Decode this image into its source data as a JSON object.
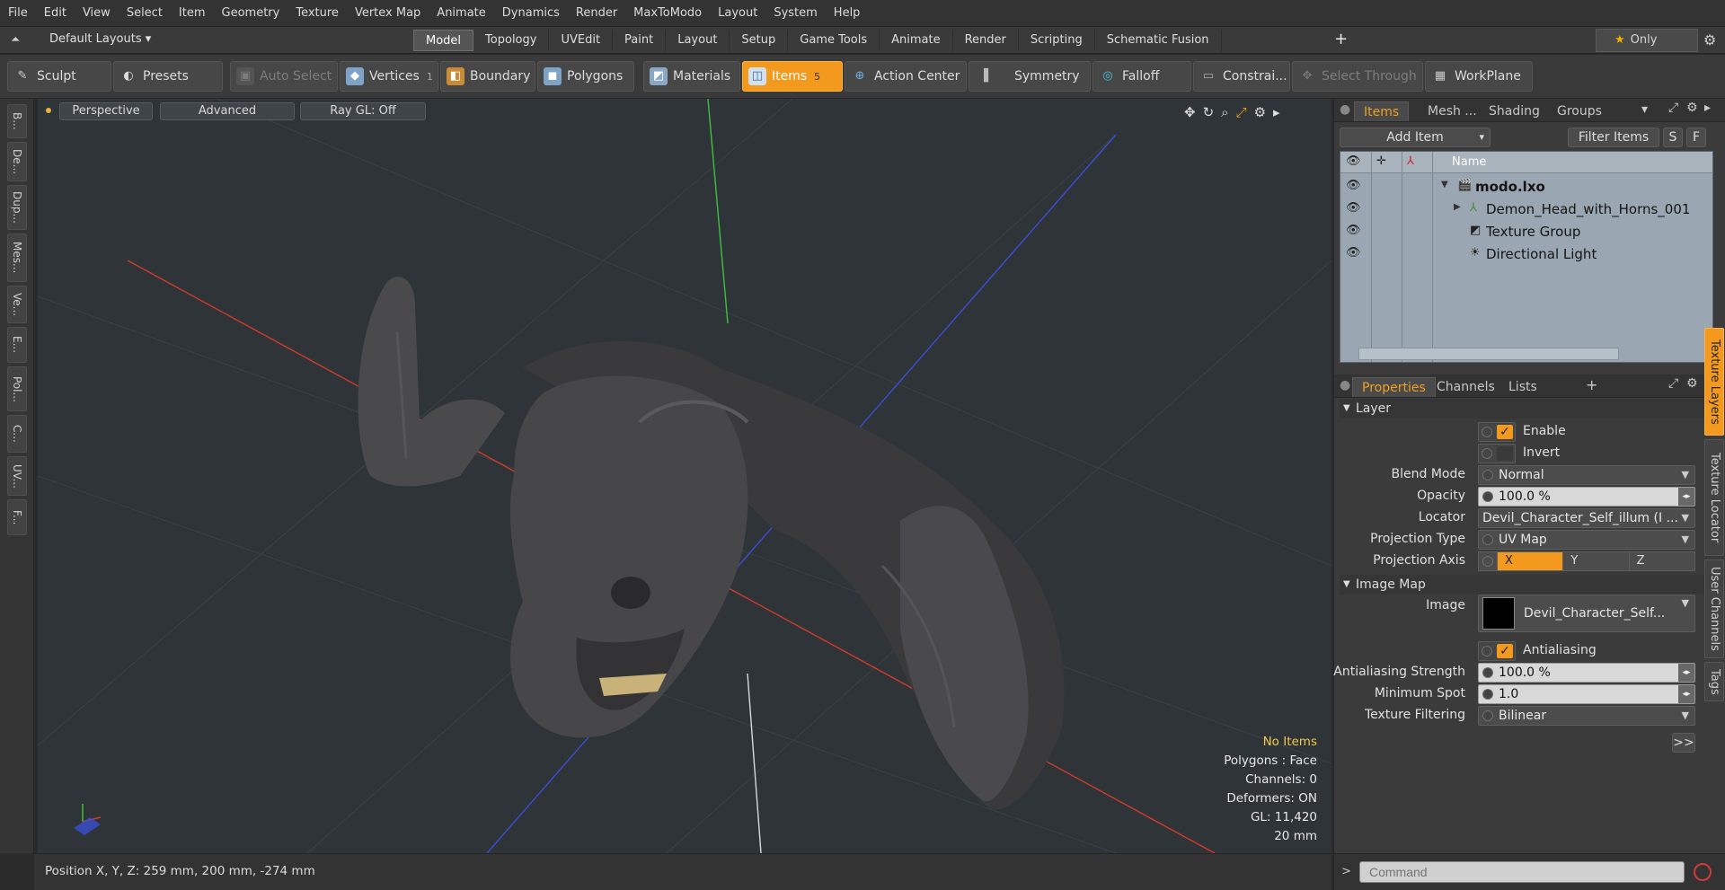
{
  "menu": [
    "File",
    "Edit",
    "View",
    "Select",
    "Item",
    "Geometry",
    "Texture",
    "Vertex Map",
    "Animate",
    "Dynamics",
    "Render",
    "MaxToModo",
    "Layout",
    "System",
    "Help"
  ],
  "layouts": {
    "label": "Default Layouts ▾"
  },
  "tabs": [
    {
      "label": "Model",
      "active": true
    },
    {
      "label": "Topology"
    },
    {
      "label": "UVEdit"
    },
    {
      "label": "Paint"
    },
    {
      "label": "Layout"
    },
    {
      "label": "Setup"
    },
    {
      "label": "Game Tools"
    },
    {
      "label": "Animate"
    },
    {
      "label": "Render"
    },
    {
      "label": "Scripting"
    },
    {
      "label": "Schematic Fusion"
    }
  ],
  "only": {
    "label": "Only"
  },
  "toolbar": {
    "sculpt": "Sculpt",
    "presets": "Presets",
    "auto_select": "Auto Select",
    "vertices": "Vertices",
    "vertices_count": "1",
    "boundary": "Boundary",
    "polygons": "Polygons",
    "materials": "Materials",
    "items": "Items",
    "items_count": "5",
    "action_center": "Action Center",
    "symmetry": "Symmetry",
    "falloff": "Falloff",
    "constraints": "Constrai...",
    "select_through": "Select Through",
    "workplane": "WorkPlane"
  },
  "left_tabs": [
    "B...",
    "De...",
    "Dup...",
    "Mes...",
    "Ve...",
    "E...",
    "Pol...",
    "C...",
    "UV...",
    "F..."
  ],
  "viewport": {
    "perspective": "Perspective",
    "advanced": "Advanced",
    "raygl": "Ray GL: Off",
    "info": {
      "no_items": "No Items",
      "polygons": "Polygons : Face",
      "channels": "Channels: 0",
      "deformers": "Deformers: ON",
      "gl": "GL: 11,420",
      "scale": "20 mm"
    }
  },
  "status": {
    "position": "Position X, Y, Z:   259 mm, 200 mm, -274 mm"
  },
  "items_panel": {
    "tabs": [
      {
        "label": "Items",
        "active": true
      },
      {
        "label": "Mesh ..."
      },
      {
        "label": "Shading"
      },
      {
        "label": "Groups"
      }
    ],
    "add_item": "Add Item",
    "filter_items": "Filter Items",
    "s": "S",
    "f": "F",
    "col_name": "Name",
    "rows": [
      {
        "name": "modo.lxo"
      },
      {
        "name": "Demon_Head_with_Horns_001"
      },
      {
        "name": "Texture Group"
      },
      {
        "name": "Directional Light"
      }
    ]
  },
  "props_panel": {
    "tabs": [
      {
        "label": "Properties",
        "active": true
      },
      {
        "label": "Channels"
      },
      {
        "label": "Lists"
      }
    ],
    "layer_header": "Layer",
    "enable": "Enable",
    "invert": "Invert",
    "blend_mode_label": "Blend Mode",
    "blend_mode": "Normal",
    "opacity_label": "Opacity",
    "opacity": "100.0 %",
    "locator_label": "Locator",
    "locator": "Devil_Character_Self_illum (I ...",
    "projection_type_label": "Projection Type",
    "projection_type": "UV Map",
    "projection_axis_label": "Projection Axis",
    "axis_x": "X",
    "axis_y": "Y",
    "axis_z": "Z",
    "image_map_header": "Image Map",
    "image_label": "Image",
    "image": "Devil_Character_Self...",
    "antialiasing": "Antialiasing",
    "aa_strength_label": "Antialiasing Strength",
    "aa_strength": "100.0 %",
    "min_spot_label": "Minimum Spot",
    "min_spot": "1.0",
    "tex_filter_label": "Texture Filtering",
    "tex_filter": "Bilinear",
    "more": ">>"
  },
  "side_tabs": [
    {
      "label": "Texture Layers",
      "active": true
    },
    {
      "label": "Texture Locator"
    },
    {
      "label": "User Channels"
    },
    {
      "label": "Tags"
    }
  ],
  "command": {
    "placeholder": "Command"
  },
  "colors": {
    "accent": "#f39a1e",
    "axis_x": "#d23b2c",
    "axis_y": "#3ec13e",
    "axis_z": "#3b4fd1"
  }
}
